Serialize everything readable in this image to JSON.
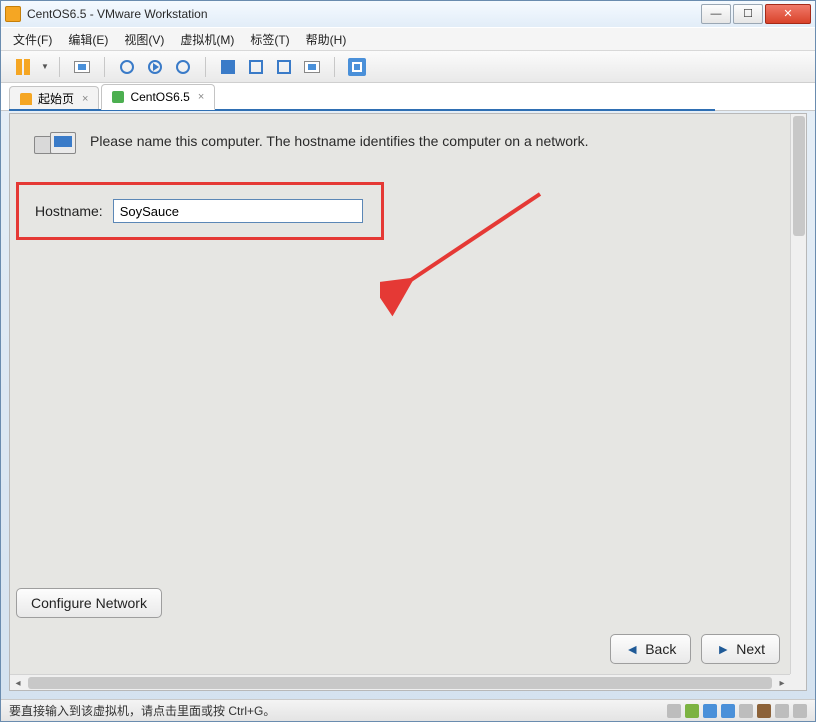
{
  "window": {
    "title": "CentOS6.5 - VMware Workstation"
  },
  "menu": {
    "file": "文件(F)",
    "edit": "编辑(E)",
    "view": "视图(V)",
    "vm": "虚拟机(M)",
    "tabs": "标签(T)",
    "help": "帮助(H)"
  },
  "tabs": {
    "home": "起始页",
    "vm": "CentOS6.5"
  },
  "installer": {
    "blurb": "Please name this computer.  The hostname identifies the computer on a network.",
    "hostname_label": "Hostname:",
    "hostname_value": "SoySauce",
    "configure_network": "Configure Network",
    "back": "Back",
    "next": "Next"
  },
  "status": {
    "hint": "要直接输入到该虚拟机，请点击里面或按 Ctrl+G。"
  }
}
